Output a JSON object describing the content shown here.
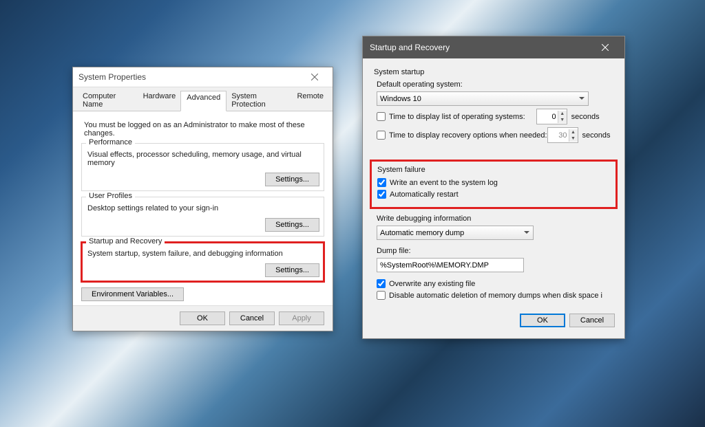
{
  "sysprops": {
    "title": "System Properties",
    "tabs": {
      "computer_name": "Computer Name",
      "hardware": "Hardware",
      "advanced": "Advanced",
      "system_protection": "System Protection",
      "remote": "Remote"
    },
    "admin_msg": "You must be logged on as an Administrator to make most of these changes.",
    "perf": {
      "legend": "Performance",
      "desc": "Visual effects, processor scheduling, memory usage, and virtual memory",
      "btn": "Settings..."
    },
    "profiles": {
      "legend": "User Profiles",
      "desc": "Desktop settings related to your sign-in",
      "btn": "Settings..."
    },
    "startup": {
      "legend": "Startup and Recovery",
      "desc": "System startup, system failure, and debugging information",
      "btn": "Settings..."
    },
    "env_btn": "Environment Variables...",
    "ok": "OK",
    "cancel": "Cancel",
    "apply": "Apply"
  },
  "recovery": {
    "title": "Startup and Recovery",
    "sys_startup": "System startup",
    "default_os_label": "Default operating system:",
    "default_os_value": "Windows 10",
    "time_os": "Time to display list of operating systems:",
    "time_os_val": "0",
    "time_recovery": "Time to display recovery options when needed:",
    "time_recovery_val": "30",
    "seconds": "seconds",
    "sys_failure": "System failure",
    "write_event": "Write an event to the system log",
    "auto_restart": "Automatically restart",
    "write_debug": "Write debugging information",
    "dump_type": "Automatic memory dump",
    "dump_file_label": "Dump file:",
    "dump_file_value": "%SystemRoot%\\MEMORY.DMP",
    "overwrite": "Overwrite any existing file",
    "disable_auto_delete": "Disable automatic deletion of memory dumps when disk space is low",
    "ok": "OK",
    "cancel": "Cancel"
  }
}
